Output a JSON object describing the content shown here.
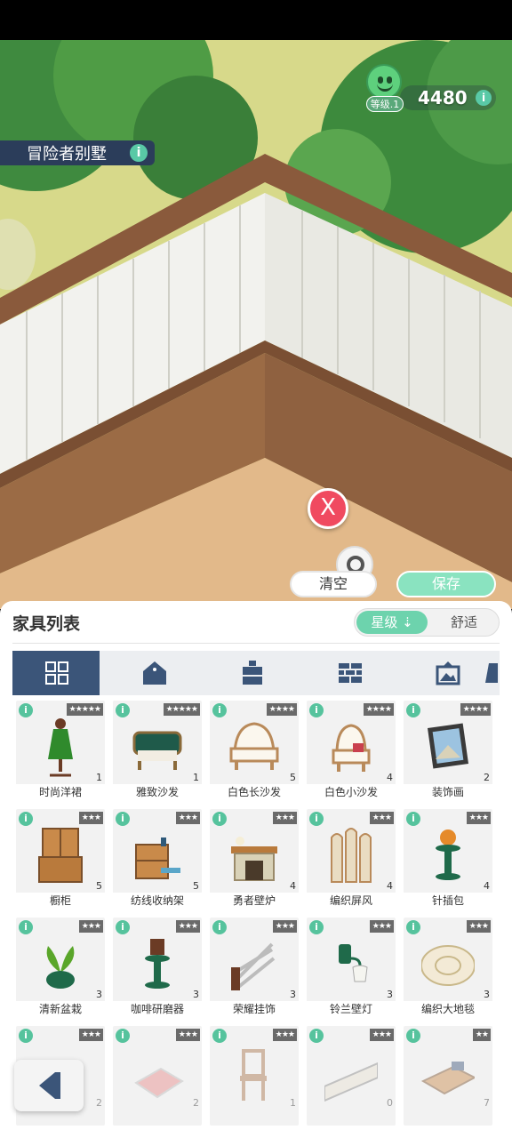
{
  "room": {
    "title": "冒险者别墅"
  },
  "player": {
    "level": "等级.1",
    "points": "4480"
  },
  "actions": {
    "clear": "清空",
    "save": "保存",
    "close": "X"
  },
  "panel": {
    "title": "家具列表",
    "sort": {
      "star": "星级",
      "comfort": "舒适"
    },
    "tabs": [
      {
        "icon": "grid-icon"
      },
      {
        "icon": "theme-tag-icon"
      },
      {
        "icon": "cabinet-icon"
      },
      {
        "icon": "wall-icon"
      },
      {
        "icon": "picture-icon"
      },
      {
        "icon": "more-icon"
      }
    ]
  },
  "furniture": [
    {
      "name": "时尚洋裙",
      "stars": "★★★★★",
      "count": "1"
    },
    {
      "name": "雅致沙发",
      "stars": "★★★★★",
      "count": "1"
    },
    {
      "name": "白色长沙发",
      "stars": "★★★★",
      "count": "5"
    },
    {
      "name": "白色小沙发",
      "stars": "★★★★",
      "count": "4"
    },
    {
      "name": "装饰画",
      "stars": "★★★★",
      "count": "2"
    },
    {
      "name": "橱柜",
      "stars": "★★★",
      "count": "5"
    },
    {
      "name": "纺线收纳架",
      "stars": "★★★",
      "count": "5"
    },
    {
      "name": "勇者壁炉",
      "stars": "★★★",
      "count": "4"
    },
    {
      "name": "编织屏风",
      "stars": "★★★",
      "count": "4"
    },
    {
      "name": "针插包",
      "stars": "★★★",
      "count": "4"
    },
    {
      "name": "清新盆栽",
      "stars": "★★★",
      "count": "3"
    },
    {
      "name": "咖啡研磨器",
      "stars": "★★★",
      "count": "3"
    },
    {
      "name": "荣耀挂饰",
      "stars": "★★★",
      "count": "3"
    },
    {
      "name": "铃兰壁灯",
      "stars": "★★★",
      "count": "3"
    },
    {
      "name": "编织大地毯",
      "stars": "★★★",
      "count": "3"
    },
    {
      "name": "",
      "stars": "★★★",
      "count": "2"
    },
    {
      "name": "",
      "stars": "★★★",
      "count": "2"
    },
    {
      "name": "",
      "stars": "★★★",
      "count": "1"
    },
    {
      "name": "",
      "stars": "★★★",
      "count": "0"
    },
    {
      "name": "",
      "stars": "★★",
      "count": "7"
    }
  ],
  "colors": {
    "accent": "#6dd3ad",
    "navy": "#3b5579",
    "danger": "#f04a60"
  }
}
